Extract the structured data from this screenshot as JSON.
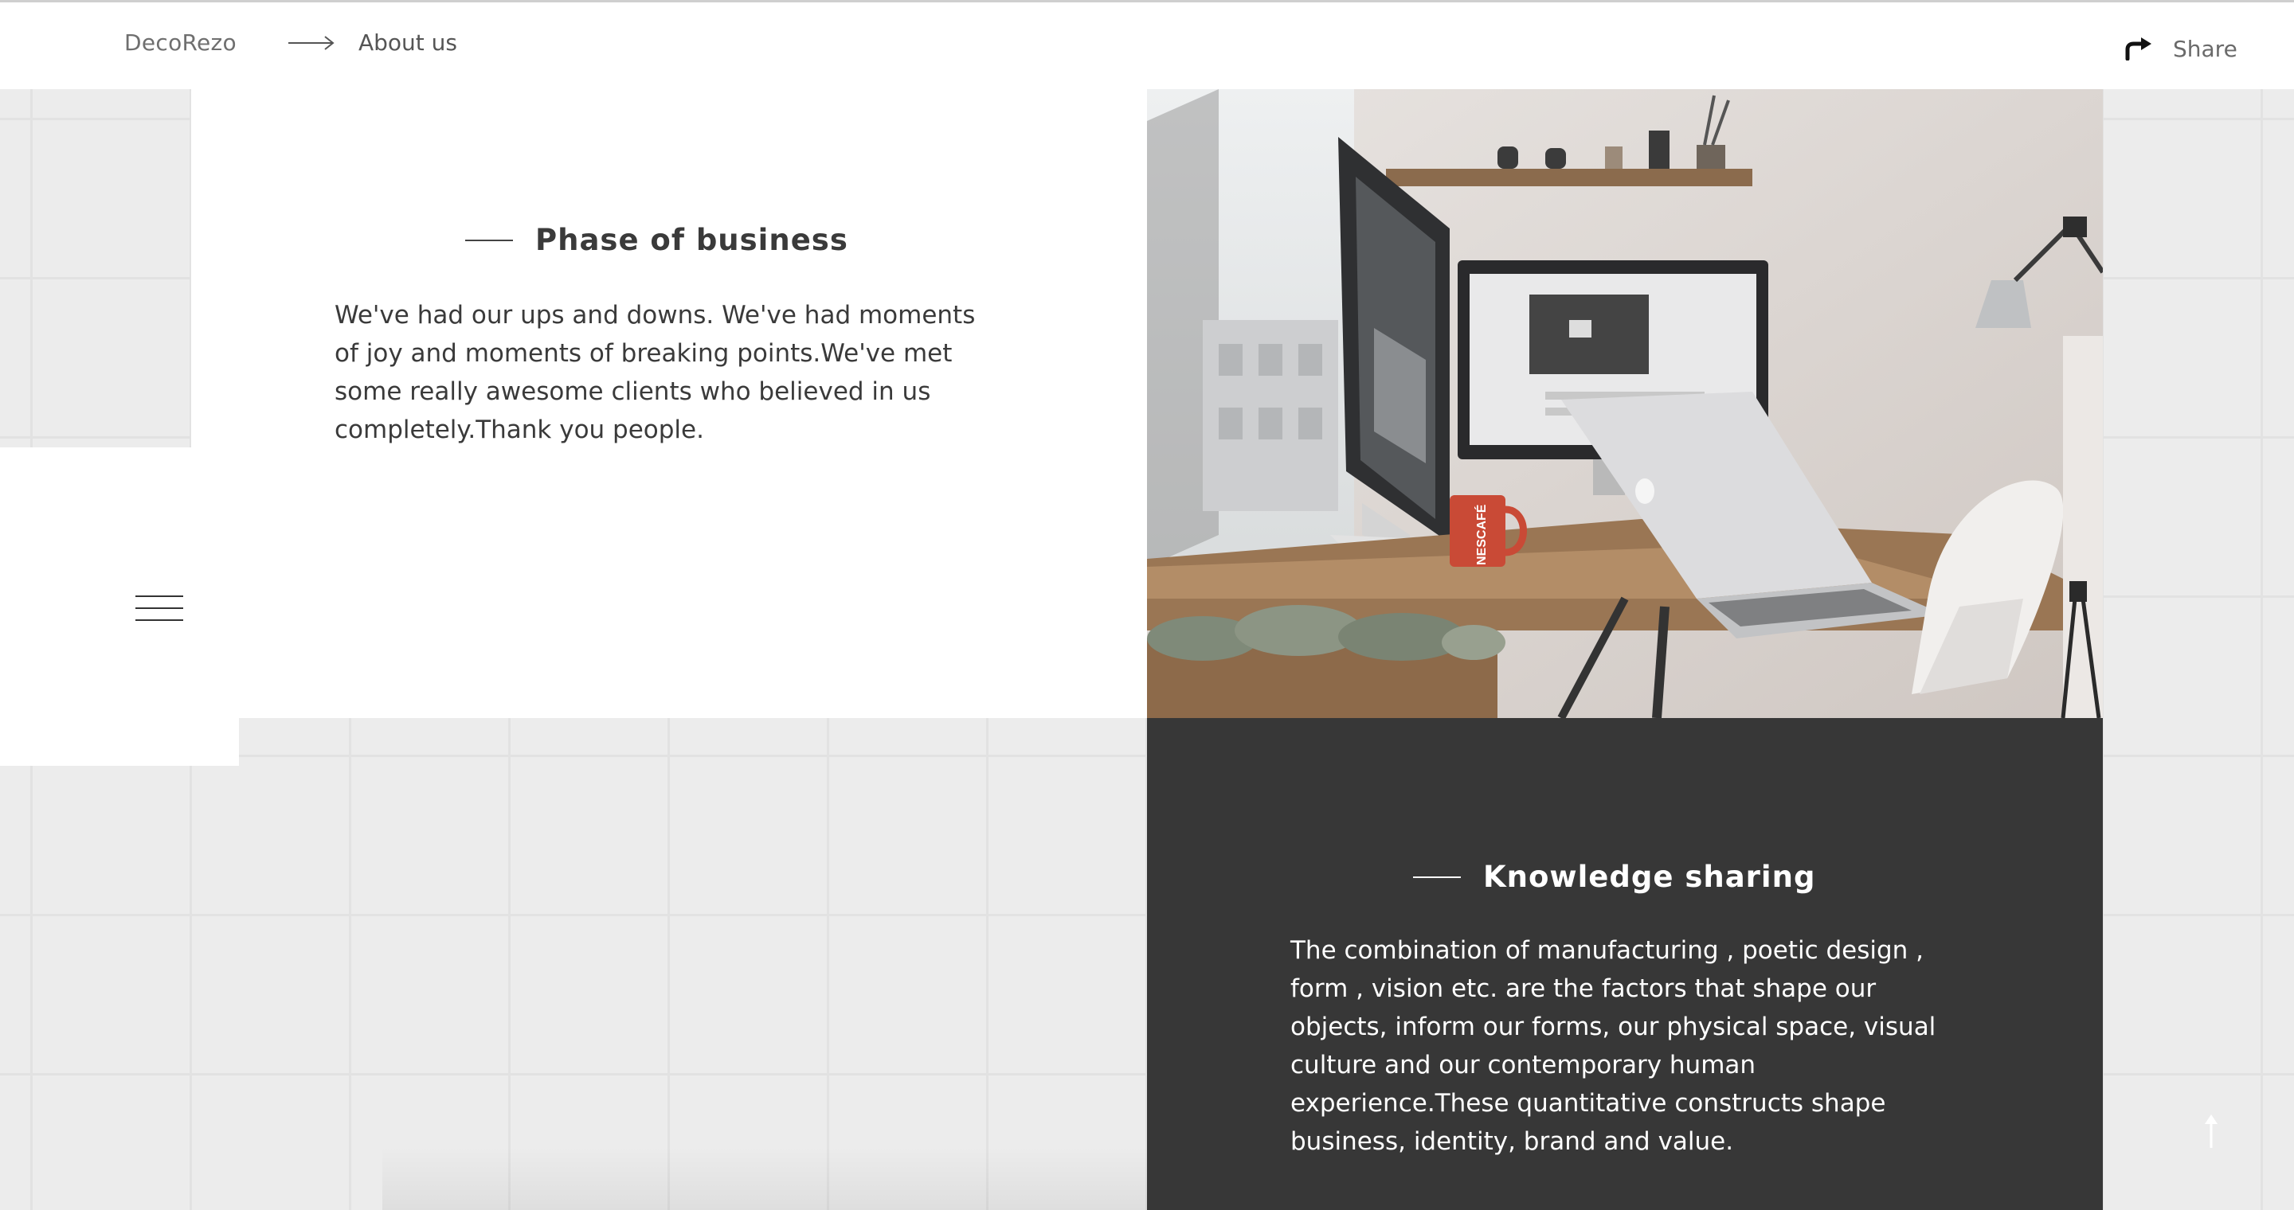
{
  "header": {
    "brand": "DecoRezo",
    "breadcrumb_current": "About us",
    "share_label": "Share"
  },
  "sections": {
    "phase": {
      "title": "Phase of business",
      "body": "We've had our ups and downs. We've had moments of joy and moments of breaking points.We've met some really awesome clients who believed in us completely.Thank you people."
    },
    "knowledge": {
      "title": "Knowledge sharing",
      "body": "The combination of manufacturing , poetic design , form , vision etc. are the factors that shape our objects, inform our forms, our physical space, visual culture and our contemporary human experience.These quantitative constructs shape business, identity, brand and value."
    }
  },
  "photo": {
    "mug_text": "NESCAFÉ"
  },
  "icons": {
    "breadcrumb": "arrow-right-icon",
    "share": "share-arrow-icon",
    "menu": "hamburger-menu-icon",
    "back_to_top": "arrow-up-icon"
  },
  "colors": {
    "page_background": "#ececec",
    "panel_dark": "#373737",
    "text_dark": "#3a3a3a",
    "mug_red": "#c94a36"
  }
}
